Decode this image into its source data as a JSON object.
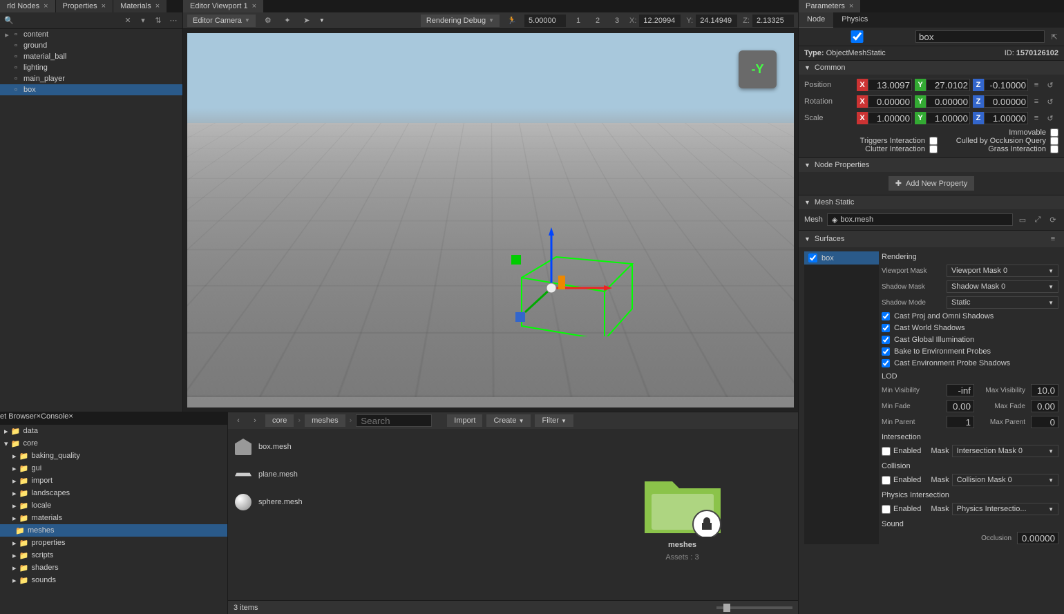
{
  "topTabs": {
    "worldNodes": "rld Nodes",
    "properties": "Properties",
    "materials": "Materials",
    "editorViewport": "Editor Viewport 1",
    "parameters": "Parameters"
  },
  "worldNodes": {
    "items": [
      {
        "label": "content",
        "indent": 1,
        "toggle": "▸"
      },
      {
        "label": "ground",
        "indent": 1,
        "toggle": ""
      },
      {
        "label": "material_ball",
        "indent": 1,
        "toggle": ""
      },
      {
        "label": "lighting",
        "indent": 1,
        "toggle": ""
      },
      {
        "label": "main_player",
        "indent": 1,
        "toggle": ""
      },
      {
        "label": "box",
        "indent": 1,
        "toggle": "",
        "selected": true
      }
    ]
  },
  "viewport": {
    "camera": "Editor Camera",
    "renderingDebug": "Rendering Debug",
    "speed": "5.00000",
    "speedPresets": [
      "1",
      "2",
      "3"
    ],
    "coords": {
      "x": "12.20994",
      "y": "24.14949",
      "z": "2.13325"
    },
    "axisWidget": "-Y"
  },
  "parameters": {
    "tabs": {
      "node": "Node",
      "physics": "Physics"
    },
    "name": "box",
    "typeLabel": "Type:",
    "type": "ObjectMeshStatic",
    "idLabel": "ID:",
    "id": "1570126102",
    "common": {
      "title": "Common",
      "position": {
        "label": "Position",
        "x": "13.0097",
        "y": "27.0102",
        "z": "-0.10000"
      },
      "rotation": {
        "label": "Rotation",
        "x": "0.00000",
        "y": "0.00000",
        "z": "0.00000"
      },
      "scale": {
        "label": "Scale",
        "x": "1.00000",
        "y": "1.00000",
        "z": "1.00000"
      },
      "immovable": "Immovable",
      "triggersInteraction": "Triggers Interaction",
      "culledByOcclusion": "Culled by Occlusion Query",
      "clutterInteraction": "Clutter Interaction",
      "grassInteraction": "Grass Interaction"
    },
    "nodeProperties": {
      "title": "Node Properties",
      "addBtn": "Add New Property"
    },
    "meshStatic": {
      "title": "Mesh Static",
      "meshLabel": "Mesh",
      "meshValue": "box.mesh"
    },
    "surfaces": {
      "title": "Surfaces",
      "list": [
        "box"
      ],
      "rendering": {
        "heading": "Rendering",
        "viewportMask": {
          "label": "Viewport Mask",
          "value": "Viewport Mask 0"
        },
        "shadowMask": {
          "label": "Shadow Mask",
          "value": "Shadow Mask 0"
        },
        "shadowMode": {
          "label": "Shadow Mode",
          "value": "Static"
        },
        "checks": [
          "Cast Proj and Omni Shadows",
          "Cast World Shadows",
          "Cast Global Illumination",
          "Bake to Environment Probes",
          "Cast Environment Probe Shadows"
        ]
      },
      "lod": {
        "heading": "LOD",
        "minVisibility": {
          "label": "Min Visibility",
          "value": "-inf"
        },
        "maxVisibility": {
          "label": "Max Visibility",
          "value": "10.0"
        },
        "minFade": {
          "label": "Min Fade",
          "value": "0.00"
        },
        "maxFade": {
          "label": "Max Fade",
          "value": "0.00"
        },
        "minParent": {
          "label": "Min Parent",
          "value": "1"
        },
        "maxParent": {
          "label": "Max Parent",
          "value": "0"
        }
      },
      "intersection": {
        "heading": "Intersection",
        "enabled": "Enabled",
        "maskLabel": "Mask",
        "mask": "Intersection Mask 0"
      },
      "collision": {
        "heading": "Collision",
        "enabled": "Enabled",
        "maskLabel": "Mask",
        "mask": "Collision Mask 0"
      },
      "physicsIntersection": {
        "heading": "Physics Intersection",
        "enabled": "Enabled",
        "maskLabel": "Mask",
        "mask": "Physics Intersectio..."
      },
      "sound": {
        "heading": "Sound",
        "occlusionLabel": "Occlusion",
        "occlusion": "0.00000"
      }
    }
  },
  "assetBrowser": {
    "tabs": {
      "browser": "et Browser",
      "console": "Console"
    },
    "folders": [
      {
        "label": "data",
        "indent": 0
      },
      {
        "label": "core",
        "indent": 0
      },
      {
        "label": "baking_quality",
        "indent": 1
      },
      {
        "label": "gui",
        "indent": 1
      },
      {
        "label": "import",
        "indent": 1
      },
      {
        "label": "landscapes",
        "indent": 1
      },
      {
        "label": "locale",
        "indent": 1
      },
      {
        "label": "materials",
        "indent": 1
      },
      {
        "label": "meshes",
        "indent": 1,
        "selected": true
      },
      {
        "label": "properties",
        "indent": 1
      },
      {
        "label": "scripts",
        "indent": 1
      },
      {
        "label": "shaders",
        "indent": 1
      },
      {
        "label": "sounds",
        "indent": 1
      }
    ],
    "breadcrumbs": [
      "core",
      "meshes"
    ],
    "searchPlaceholder": "Search",
    "buttons": {
      "import": "Import",
      "create": "Create",
      "filter": "Filter"
    },
    "files": [
      "box.mesh",
      "plane.mesh",
      "sphere.mesh"
    ],
    "preview": {
      "name": "meshes",
      "subtitle": "Assets : 3"
    },
    "status": "3 items"
  }
}
